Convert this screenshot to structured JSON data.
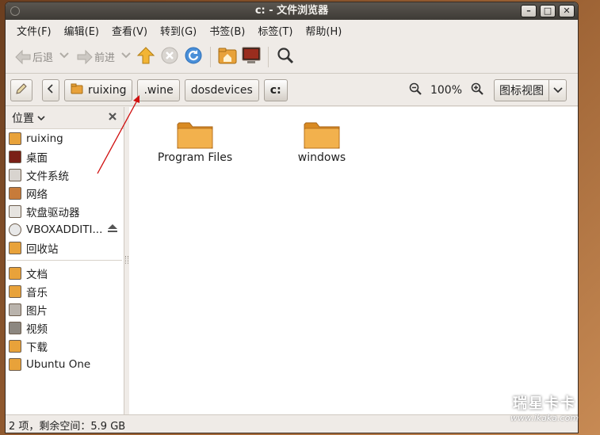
{
  "window": {
    "title": "c: - 文件浏览器"
  },
  "menubar": {
    "items": [
      "文件(F)",
      "编辑(E)",
      "查看(V)",
      "转到(G)",
      "书签(B)",
      "标签(T)",
      "帮助(H)"
    ]
  },
  "toolbar": {
    "back_label": "后退",
    "forward_label": "前进"
  },
  "location": {
    "crumbs": [
      "ruixing",
      ".wine",
      "dosdevices",
      "c:"
    ],
    "zoom": "100%",
    "view_mode": "图标视图"
  },
  "sidebar": {
    "header": "位置",
    "items": [
      {
        "label": "ruixing",
        "icon": "home-folder-icon"
      },
      {
        "label": "桌面",
        "icon": "desktop-icon"
      },
      {
        "label": "文件系统",
        "icon": "filesystem-icon"
      },
      {
        "label": "网络",
        "icon": "network-icon"
      },
      {
        "label": "软盘驱动器",
        "icon": "floppy-icon"
      },
      {
        "label": "VBOXADDITI...",
        "icon": "cdrom-icon"
      },
      {
        "label": "回收站",
        "icon": "trash-icon"
      },
      {
        "label": "文档",
        "icon": "documents-folder-icon"
      },
      {
        "label": "音乐",
        "icon": "music-folder-icon"
      },
      {
        "label": "图片",
        "icon": "pictures-folder-icon"
      },
      {
        "label": "视频",
        "icon": "videos-folder-icon"
      },
      {
        "label": "下载",
        "icon": "downloads-folder-icon"
      },
      {
        "label": "Ubuntu One",
        "icon": "folder-icon"
      }
    ]
  },
  "files": [
    {
      "name": "Program Files",
      "icon": "folder-icon"
    },
    {
      "name": "windows",
      "icon": "folder-icon"
    }
  ],
  "statusbar": {
    "text": "2 项，剩余空间：5.9 GB"
  },
  "watermark": {
    "main": "瑞星卡卡",
    "url": "www.ikaka.com"
  },
  "colors": {
    "folder": "#e8a23a",
    "annotation_arrow": "#d01010",
    "titlebar": "#3e3b36"
  }
}
